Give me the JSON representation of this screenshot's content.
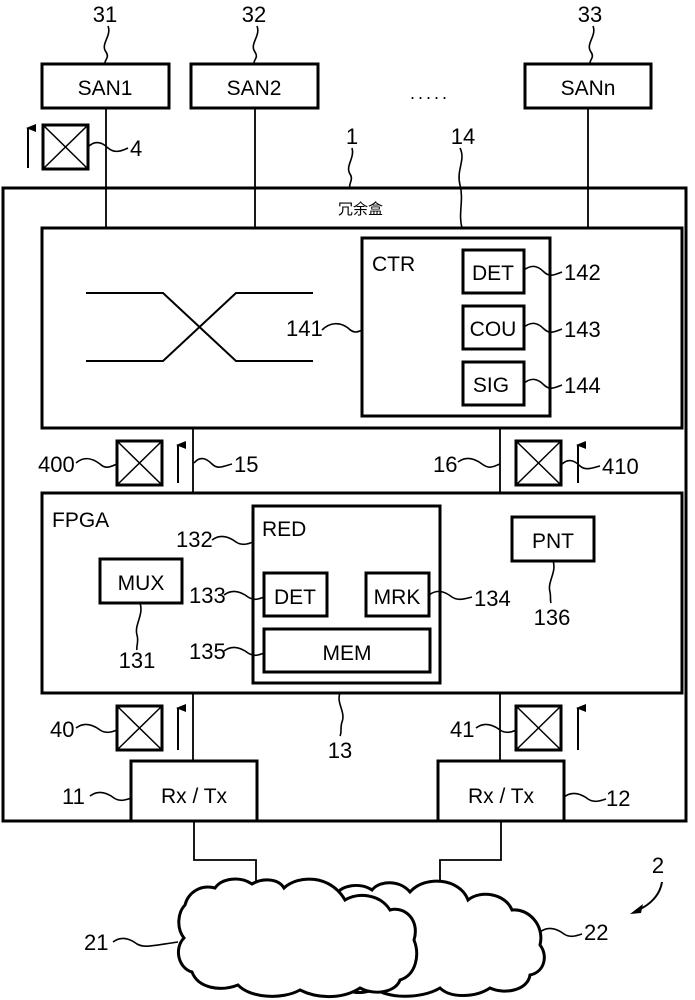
{
  "figure": {
    "ellipsis": ".....",
    "redundancy_box": {
      "ref": "1",
      "caption": "冗余盒"
    },
    "san_nodes": [
      {
        "ref": "31",
        "label": "SAN1"
      },
      {
        "ref": "32",
        "label": "SAN2"
      },
      {
        "ref": "33",
        "label": "SANn"
      }
    ],
    "switch_block": {
      "ref": "14",
      "crossover_ref": "141"
    },
    "controller": {
      "label": "CTR",
      "modules": [
        {
          "ref": "142",
          "label": "DET"
        },
        {
          "ref": "143",
          "label": "COU"
        },
        {
          "ref": "144",
          "label": "SIG"
        }
      ]
    },
    "links": {
      "left": "15",
      "right": "16"
    },
    "packets": {
      "top": "4",
      "upper_left": "400",
      "upper_right": "410",
      "lower_left": "40",
      "lower_right": "41"
    },
    "fpga": {
      "label": "FPGA",
      "ref": "13",
      "mux": {
        "ref": "131",
        "label": "MUX"
      },
      "red": {
        "ref": "132",
        "label": "RED",
        "det": {
          "ref": "133",
          "label": "DET"
        },
        "mrk": {
          "ref": "134",
          "label": "MRK"
        },
        "mem": {
          "ref": "135",
          "label": "MEM"
        }
      },
      "pnt": {
        "ref": "136",
        "label": "PNT"
      }
    },
    "transceivers": [
      {
        "ref": "11",
        "label": "Rx / Tx"
      },
      {
        "ref": "12",
        "label": "Rx / Tx"
      }
    ],
    "network": {
      "ref": "2",
      "clouds": [
        "21",
        "22"
      ]
    }
  }
}
